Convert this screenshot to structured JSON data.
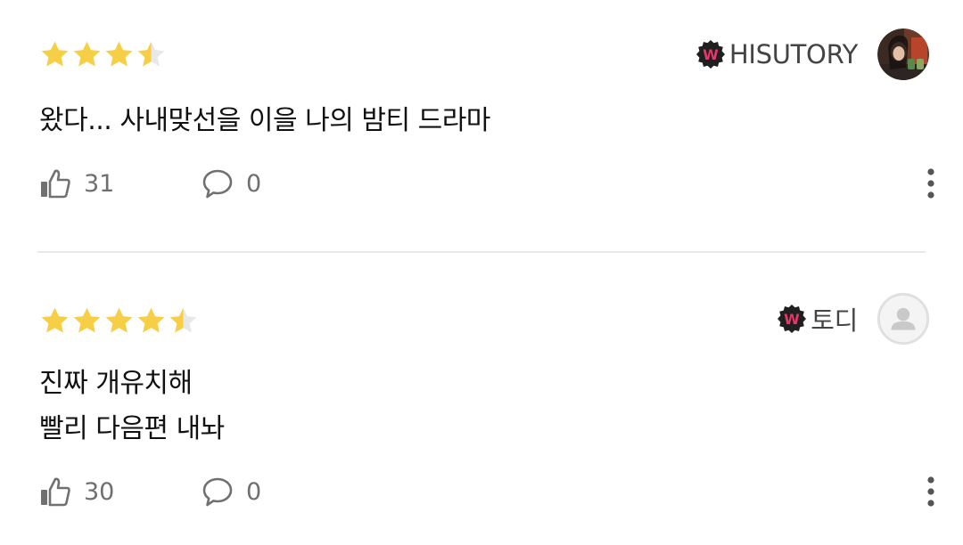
{
  "reviews": [
    {
      "rating": 3.5,
      "max_rating": 5,
      "author": "HISUTORY",
      "author_badge_icon": "w-badge-icon",
      "avatar": "user-photo",
      "text": "왔다... 사내맞선을 이을 나의 밤티 드라마",
      "likes": "31",
      "comments": "0"
    },
    {
      "rating": 4.5,
      "max_rating": 5,
      "author": "토디",
      "author_badge_icon": "w-badge-icon",
      "avatar": "default-avatar",
      "text": "진짜 개유치해\n빨리 다음편 내놔",
      "likes": "30",
      "comments": "0"
    }
  ],
  "colors": {
    "star_filled": "#f7cf47",
    "star_empty": "#e8e8e8",
    "badge_bg": "#1f1f1f",
    "badge_letter": "#e8366b",
    "icon_gray": "#707070",
    "divider": "#e9e9e9"
  }
}
